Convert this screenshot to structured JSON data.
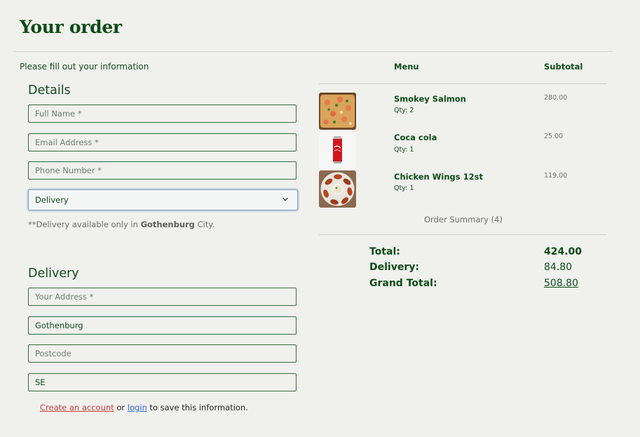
{
  "header": {
    "title": "Your order"
  },
  "form": {
    "intro": "Please fill out your information",
    "details_heading": "Details",
    "full_name_placeholder": "Full Name *",
    "email_placeholder": "Email Address *",
    "phone_placeholder": "Phone Number *",
    "method_selected": "Delivery",
    "note_prefix": "**Delivery available only in ",
    "note_city": "Gothenburg",
    "note_suffix": " City.",
    "delivery_heading": "Delivery",
    "address_placeholder": "Your Address *",
    "city_value": "Gothenburg",
    "postcode_placeholder": "Postcode",
    "country_value": "SE",
    "create_account_label": "Create an account",
    "or_text": " or ",
    "login_label": "login",
    "save_suffix": " to save this information."
  },
  "order": {
    "menu_header": "Menu",
    "subtotal_header": "Subtotal",
    "items": [
      {
        "name": "Smokey Salmon",
        "qty": "Qty: 2",
        "price": "280.00",
        "image": "salmon-pizza-photo"
      },
      {
        "name": "Coca cola",
        "qty": "Qty: 1",
        "price": "25.00",
        "image": "coca-cola-can-photo"
      },
      {
        "name": "Chicken Wings 12st",
        "qty": "Qty: 1",
        "price": "119.00",
        "image": "chicken-wings-photo"
      }
    ],
    "summary_label": "Order Summary (4)",
    "total_label": "Total:",
    "total_value": "424.00",
    "delivery_label": "Delivery:",
    "delivery_value": "84.80",
    "grand_total_label": "Grand Total:",
    "grand_total_value": "508.80"
  },
  "colors": {
    "brand_green": "#0c4b16",
    "background": "#f0f0ed",
    "link_red": "#c53a3a",
    "link_blue": "#2a66c8"
  }
}
